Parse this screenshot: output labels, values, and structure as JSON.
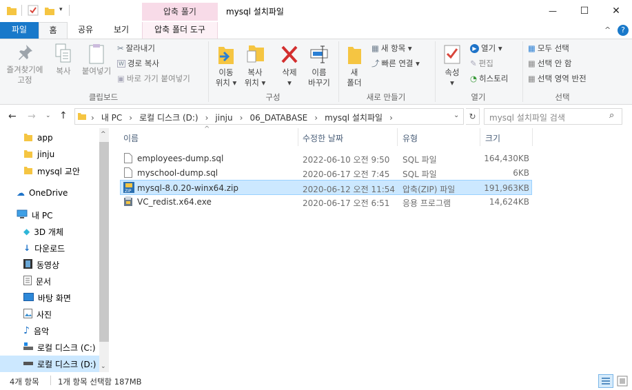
{
  "window": {
    "context_tab_header": "압축 풀기",
    "title": "mysql 설치파일",
    "minimize": "—",
    "maximize": "☐",
    "close": "✕"
  },
  "tabs": {
    "file": "파일",
    "home": "홈",
    "share": "공유",
    "view": "보기",
    "compressed_tools": "압축 폴더 도구"
  },
  "ribbon": {
    "clipboard": {
      "pin_quick_access": "즐겨찾기에\n고정",
      "copy": "복사",
      "paste": "붙여넣기",
      "cut": "잘라내기",
      "copy_path": "경로 복사",
      "paste_shortcut": "바로 가기 붙여넣기",
      "group": "클립보드"
    },
    "organize": {
      "move_to": "이동\n위치 ▾",
      "copy_to": "복사\n위치 ▾",
      "delete": "삭제\n▾",
      "rename": "이름\n바꾸기",
      "group": "구성"
    },
    "new": {
      "new_folder": "새\n폴더",
      "new_item": "새 항목 ▾",
      "easy_access": "빠른 연결 ▾",
      "group": "새로 만들기"
    },
    "open": {
      "properties": "속성\n▾",
      "open": "열기 ▾",
      "edit": "편집",
      "history": "히스토리",
      "group": "열기"
    },
    "select": {
      "select_all": "모두 선택",
      "select_none": "선택 안 함",
      "invert_selection": "선택 영역 반전",
      "group": "선택"
    }
  },
  "address": {
    "crumbs": [
      "내 PC",
      "로컬 디스크 (D:)",
      "jinju",
      "06_DATABASE",
      "mysql 설치파일"
    ],
    "search_placeholder": "mysql 설치파일 검색"
  },
  "nav_pane": {
    "quick": [
      "app",
      "jinju",
      "mysql 교안"
    ],
    "onedrive": "OneDrive",
    "this_pc": "내 PC",
    "pc_items": [
      "3D 개체",
      "다운로드",
      "동영상",
      "문서",
      "바탕 화면",
      "사진",
      "음악",
      "로컬 디스크 (C:)",
      "로컬 디스크 (D:)"
    ]
  },
  "file_list": {
    "headers": {
      "name": "이름",
      "date": "수정한 날짜",
      "type": "유형",
      "size": "크기"
    },
    "rows": [
      {
        "name": "employees-dump.sql",
        "date": "2022-06-10 오전 9:50",
        "type": "SQL 파일",
        "size": "164,430KB"
      },
      {
        "name": "myschool-dump.sql",
        "date": "2020-06-17 오전 7:45",
        "type": "SQL 파일",
        "size": "6KB"
      },
      {
        "name": "mysql-8.0.20-winx64.zip",
        "date": "2020-06-12 오전 11:54",
        "type": "압축(ZIP) 파일",
        "size": "191,963KB"
      },
      {
        "name": "VC_redist.x64.exe",
        "date": "2020-06-17 오전 6:51",
        "type": "응용 프로그램",
        "size": "14,624KB"
      }
    ]
  },
  "status": {
    "item_count": "4개 항목",
    "selection": "1개 항목 선택함 187MB"
  },
  "colors": {
    "file_tab": "#1979ca",
    "context_header": "#f8dbe8",
    "selection": "#cce8ff"
  }
}
